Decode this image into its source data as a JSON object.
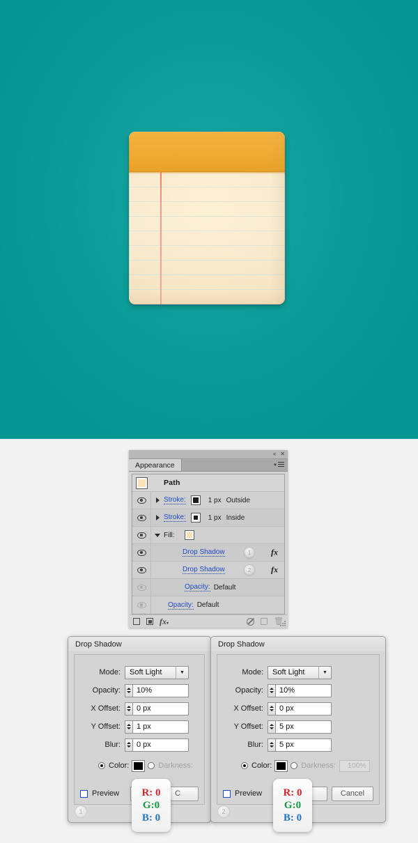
{
  "artboard": {
    "background_color": "#059f9a",
    "illustration": {
      "name": "notepad-icon",
      "header_color": "#efac36",
      "paper_color": "#fdeccb",
      "rule_color": "#d9e3d6",
      "margin_line_color": "#ec6a5a",
      "rule_count": 9
    }
  },
  "page_background": "#f2f2f2",
  "panel": {
    "tab_label": "Appearance",
    "titlebar": {
      "collapse_icon": "«",
      "close_icon": "✕"
    },
    "menu_icon": "panel-menu-icon",
    "object_title": "Path",
    "rows": [
      {
        "id": "stroke-outside",
        "disclosure": "right",
        "label": "Stroke:",
        "is_link": true,
        "swatch_type": "solid-black",
        "value": "1 px",
        "value2": "Outside",
        "eye": "on"
      },
      {
        "id": "stroke-inside",
        "disclosure": "right",
        "label": "Stroke:",
        "is_link": true,
        "swatch_type": "ring-black",
        "value": "1 px",
        "value2": "Inside",
        "eye": "on"
      },
      {
        "id": "fill",
        "disclosure": "down",
        "label": "Fill:",
        "is_link": false,
        "swatch_type": "cream",
        "value": "",
        "value2": "",
        "eye": "on"
      },
      {
        "id": "drop-shadow-1",
        "label": "Drop Shadow",
        "is_link": true,
        "badge": "1",
        "fx": "fx",
        "eye": "on"
      },
      {
        "id": "drop-shadow-2",
        "label": "Drop Shadow",
        "is_link": true,
        "badge": "2",
        "fx": "fx",
        "eye": "on"
      },
      {
        "id": "opacity-inner",
        "label": "Opacity:",
        "is_link": true,
        "value": "Default",
        "eye": "off"
      },
      {
        "id": "opacity-outer",
        "label": "Opacity:",
        "is_link": true,
        "value": "Default",
        "eye": "off"
      }
    ],
    "footer": {
      "add_new_stroke": "add-new-stroke-icon",
      "add_new_fill": "add-new-fill-icon",
      "add_effect": "fx",
      "clear_appearance": "clear-appearance-icon",
      "duplicate_item": "duplicate-item-icon",
      "delete_item": "delete-item-icon"
    }
  },
  "dialogs": [
    {
      "number": "1",
      "title": "Drop Shadow",
      "fields": [
        {
          "label": "Mode:",
          "type": "select",
          "value": "Soft Light"
        },
        {
          "label": "Opacity:",
          "type": "spinner",
          "value": "10%"
        },
        {
          "label": "X Offset:",
          "type": "spinner",
          "value": "0 px"
        },
        {
          "label": "Y Offset:",
          "type": "spinner",
          "value": "1 px"
        },
        {
          "label": "Blur:",
          "type": "spinner",
          "value": "0 px"
        }
      ],
      "color_radio_label": "Color:",
      "color_radio_selected": true,
      "color_value": "#000000",
      "darkness_radio_label": "Darkness:",
      "darkness_value": "",
      "preview_label": "Preview",
      "preview_checked": false,
      "ok_label": "",
      "cancel_label": "C",
      "rgb_tooltip": {
        "r": "R: 0",
        "g": "G:0",
        "b": "B: 0"
      }
    },
    {
      "number": "2",
      "title": "Drop Shadow",
      "fields": [
        {
          "label": "Mode:",
          "type": "select",
          "value": "Soft Light"
        },
        {
          "label": "Opacity:",
          "type": "spinner",
          "value": "10%"
        },
        {
          "label": "X Offset:",
          "type": "spinner",
          "value": "0 px"
        },
        {
          "label": "Y Offset:",
          "type": "spinner",
          "value": "5 px"
        },
        {
          "label": "Blur:",
          "type": "spinner",
          "value": "5 px"
        }
      ],
      "color_radio_label": "Color:",
      "color_radio_selected": true,
      "color_value": "#000000",
      "darkness_radio_label": "Darkness:",
      "darkness_value": "100%",
      "preview_label": "Preview",
      "preview_checked": false,
      "ok_label": "",
      "cancel_label": "Cancel",
      "rgb_tooltip": {
        "r": "R: 0",
        "g": "G:0",
        "b": "B: 0"
      }
    }
  ]
}
